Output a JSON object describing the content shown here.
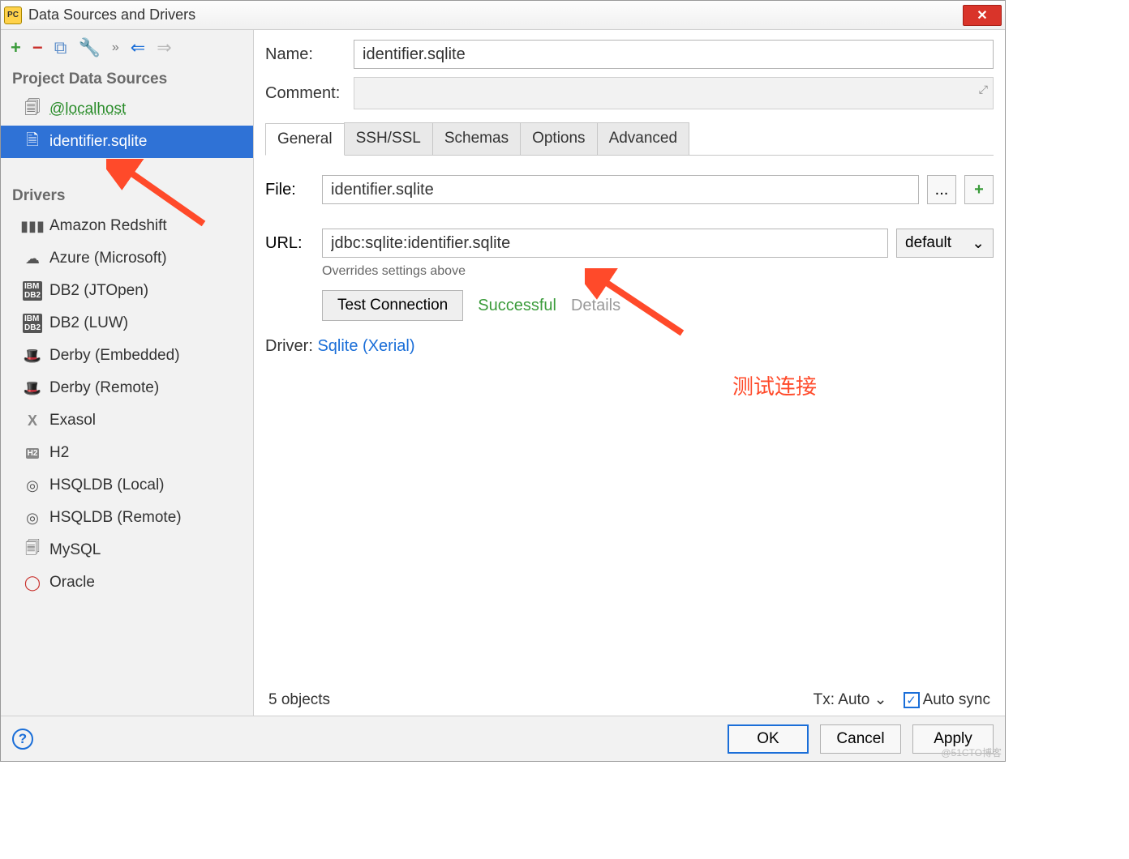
{
  "title": "Data Sources and Drivers",
  "sidebar": {
    "section_sources": "Project Data Sources",
    "section_drivers": "Drivers",
    "sources": [
      {
        "label": "@localhost"
      },
      {
        "label": "identifier.sqlite"
      }
    ],
    "drivers": [
      {
        "label": "Amazon Redshift"
      },
      {
        "label": "Azure (Microsoft)"
      },
      {
        "label": "DB2 (JTOpen)"
      },
      {
        "label": "DB2 (LUW)"
      },
      {
        "label": "Derby (Embedded)"
      },
      {
        "label": "Derby (Remote)"
      },
      {
        "label": "Exasol"
      },
      {
        "label": "H2"
      },
      {
        "label": "HSQLDB (Local)"
      },
      {
        "label": "HSQLDB (Remote)"
      },
      {
        "label": "MySQL"
      },
      {
        "label": "Oracle"
      }
    ]
  },
  "form": {
    "name_label": "Name:",
    "name_value": "identifier.sqlite",
    "comment_label": "Comment:",
    "tabs": [
      "General",
      "SSH/SSL",
      "Schemas",
      "Options",
      "Advanced"
    ],
    "file_label": "File:",
    "file_value": "identifier.sqlite",
    "browse_label": "...",
    "url_label": "URL:",
    "url_value": "jdbc:sqlite:identifier.sqlite",
    "url_mode": "default",
    "url_hint": "Overrides settings above",
    "test_label": "Test Connection",
    "test_status": "Successful",
    "details_label": "Details",
    "driver_label": "Driver:",
    "driver_link": "Sqlite (Xerial)",
    "objects": "5 objects",
    "tx_label": "Tx: Auto",
    "autosync_label": "Auto sync"
  },
  "annot": "测试连接",
  "buttons": {
    "ok": "OK",
    "cancel": "Cancel",
    "apply": "Apply"
  },
  "watermark": "@51CTO博客"
}
